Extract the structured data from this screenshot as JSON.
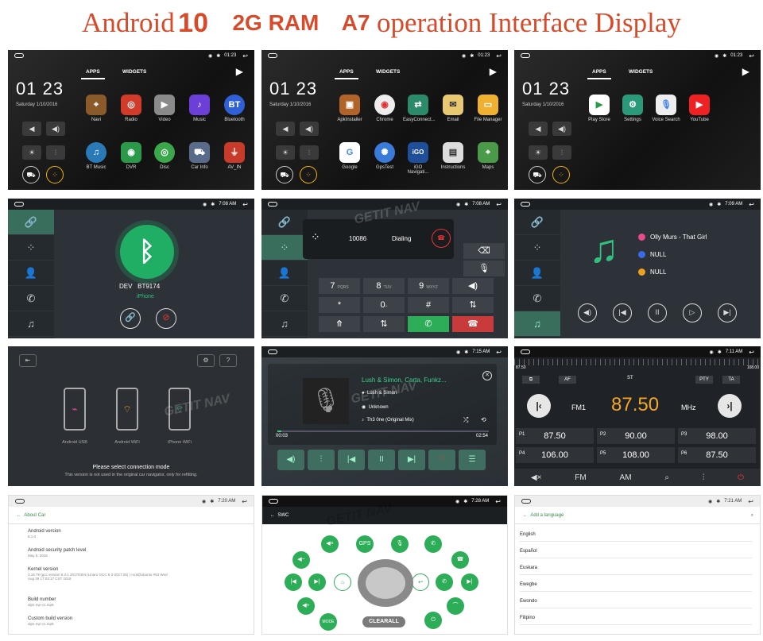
{
  "banner": {
    "android": "Android",
    "ten": "10",
    "ram": "2G RAM",
    "a7": "A7",
    "rest": "operation Interface Display"
  },
  "status": {
    "time1": "01:23",
    "time2": "7:08 AM",
    "time3": "7:09 AM",
    "time4": "7:15 AM",
    "time5": "7:11 AM",
    "time6": "7:20 AM",
    "time7": "7:28 AM",
    "time8": "7:21 AM"
  },
  "home": {
    "clock": "01 23",
    "date": "Saturday 1/10/2016",
    "tab_apps": "APPS",
    "tab_widgets": "WIDGETS",
    "apps1": [
      "Navi",
      "Radio",
      "Video",
      "Music",
      "Bluetooth",
      "BT Music",
      "DVR",
      "Disc",
      "Car Info",
      "AV_IN"
    ],
    "apps2": [
      "ApkInstaller",
      "Chrome",
      "EasyConnect...",
      "Email",
      "File Manager",
      "Google",
      "GpsTest",
      "iGO Navigati...",
      "Instructions",
      "Maps"
    ],
    "apps3": [
      "Play Store",
      "Settings",
      "Voice Search",
      "YouTube"
    ]
  },
  "bt": {
    "dev_label": "DEV",
    "dev_name": "BT9174",
    "phone": "iPhone"
  },
  "dialer": {
    "number": "10086",
    "state": "Dialing",
    "keys": [
      "7",
      "8",
      "9",
      "*",
      "0",
      "#"
    ],
    "subs": [
      "PQRS",
      "TUV",
      "WXYZ",
      "",
      "+",
      ""
    ]
  },
  "btmusic": {
    "track": "Olly Murs - That Girl",
    "album": "NULL",
    "artist": "NULL"
  },
  "connect": {
    "phones": [
      "Android USB",
      "Android WiFi",
      "iPhone WiFi"
    ],
    "msg": "Please select connection mode",
    "note": "This version is not used in the original car navigator, only for refitting."
  },
  "media": {
    "title": "Lush & Simon, Carta, Funkz...",
    "artist": "Lush & Simon",
    "album": "Unknown",
    "song": "Th3 0ne (Original Mix)",
    "pos": "00:03",
    "dur": "02:54",
    "progress": 0.02
  },
  "radio": {
    "min": "87.50",
    "max": "108.00",
    "af_label": "AF",
    "st_label": "ST",
    "pty_label": "PTY",
    "ta_label": "TA",
    "band": "FM1",
    "freq": "87.50",
    "unit": "MHz",
    "presets": [
      {
        "n": "P1",
        "v": "87.50"
      },
      {
        "n": "P2",
        "v": "90.00"
      },
      {
        "n": "P3",
        "v": "98.00"
      },
      {
        "n": "P4",
        "v": "106.00"
      },
      {
        "n": "P5",
        "v": "108.00"
      },
      {
        "n": "P6",
        "v": "87.50"
      }
    ],
    "bottom": [
      "FM",
      "AM"
    ]
  },
  "about": {
    "header": "About Car",
    "items": [
      {
        "t": "Android version",
        "s": "8.1.0"
      },
      {
        "t": "Android security patch level",
        "s": "May 5, 2018"
      },
      {
        "t": "Kernel version",
        "s": "3.18.79 (gcc version 6.3.1 20170404 (Linaro GCC 6.3-2017.05) ) root@ubuntu #53 Wed Aug 29 17:03:17 CST 2018"
      },
      {
        "t": "Build number",
        "s": "alps-mp-o1.mp5"
      },
      {
        "t": "Custom build version",
        "s": "alps-mp-o1.mp5"
      }
    ]
  },
  "swc": {
    "header": "SWC",
    "gps": "GPS",
    "mode": "MODE",
    "clear": "CLEARALL"
  },
  "lang": {
    "header": "Add a language",
    "items": [
      "English",
      "Español",
      "Euskara",
      "Ewegbe",
      "Ewondo",
      "Filipino"
    ]
  },
  "watermark": "GETIT NAV",
  "colors": {
    "banner": "#d74a2a",
    "green": "#2dad57",
    "teal": "#1fae63"
  }
}
